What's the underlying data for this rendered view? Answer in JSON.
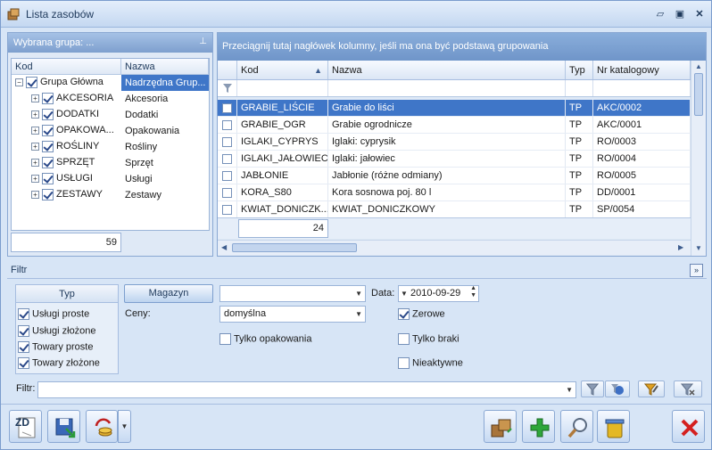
{
  "window": {
    "title": "Lista zasobów"
  },
  "left_panel": {
    "header": "Wybrana grupa: ...",
    "columns": [
      "Kod",
      "Nazwa"
    ],
    "tree": [
      {
        "kod": "Grupa Główna",
        "nazwa": "Nadrzędna Grup..."
      },
      {
        "kod": "AKCESORIA",
        "nazwa": "Akcesoria"
      },
      {
        "kod": "DODATKI",
        "nazwa": "Dodatki"
      },
      {
        "kod": "OPAKOWA...",
        "nazwa": "Opakowania"
      },
      {
        "kod": "ROŚLINY",
        "nazwa": "Rośliny"
      },
      {
        "kod": "SPRZĘT",
        "nazwa": "Sprzęt"
      },
      {
        "kod": "USŁUGI",
        "nazwa": "Usługi"
      },
      {
        "kod": "ZESTAWY",
        "nazwa": "Zestawy"
      }
    ],
    "count": "59"
  },
  "grid": {
    "group_hint": "Przeciągnij tutaj nagłówek kolumny, jeśli ma ona być podstawą grupowania",
    "columns": [
      "Kod",
      "Nazwa",
      "Typ",
      "Nr katalogowy"
    ],
    "rows": [
      {
        "kod": "GRABIE_LIŚCIE",
        "nazwa": "Grabie do liści",
        "typ": "TP",
        "nr": "AKC/0002"
      },
      {
        "kod": "GRABIE_OGR",
        "nazwa": "Grabie ogrodnicze",
        "typ": "TP",
        "nr": "AKC/0001"
      },
      {
        "kod": "IGLAKI_CYPRYS",
        "nazwa": "Iglaki: cyprysik",
        "typ": "TP",
        "nr": "RO/0003"
      },
      {
        "kod": "IGLAKI_JAŁOWIEC",
        "nazwa": "Iglaki: jałowiec",
        "typ": "TP",
        "nr": "RO/0004"
      },
      {
        "kod": "JABŁONIE",
        "nazwa": "Jabłonie (różne odmiany)",
        "typ": "TP",
        "nr": "RO/0005"
      },
      {
        "kod": "KORA_S80",
        "nazwa": "Kora sosnowa poj. 80 l",
        "typ": "TP",
        "nr": "DD/0001"
      },
      {
        "kod": "KWIAT_DONICZK...",
        "nazwa": "KWIAT_DONICZKOWY",
        "typ": "TP",
        "nr": "SP/0054"
      }
    ],
    "count": "24"
  },
  "filter": {
    "title": "Filtr",
    "typ_tab": "Typ",
    "typ_options": [
      {
        "label": "Usługi proste",
        "checked": true
      },
      {
        "label": "Usługi złożone",
        "checked": true
      },
      {
        "label": "Towary proste",
        "checked": true
      },
      {
        "label": "Towary złożone",
        "checked": true
      }
    ],
    "magazyn_button": "Magazyn",
    "magazyn_value": "",
    "data_label": "Data:",
    "data_value": "2010-09-29",
    "ceny_label": "Ceny:",
    "ceny_value": "domyślna",
    "zerowe": "Zerowe",
    "tylko_opakowania": "Tylko opakowania",
    "tylko_braki": "Tylko braki",
    "nieaktywne": "Nieaktywne",
    "filtr_label": "Filtr:",
    "filtr_value": ""
  },
  "toolbar": {
    "zd_label": "ZD"
  }
}
